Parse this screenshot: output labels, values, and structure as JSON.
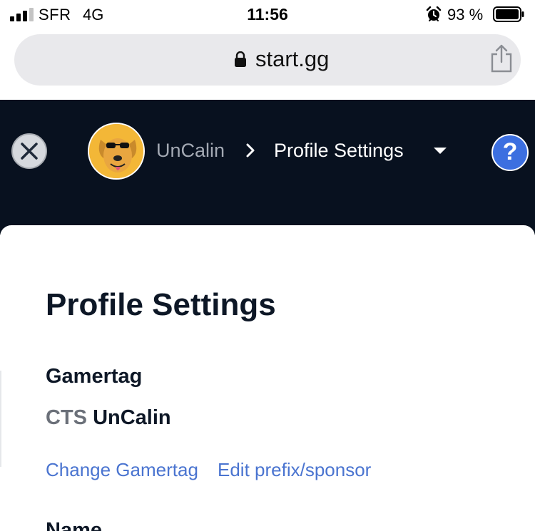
{
  "status_bar": {
    "carrier": "SFR",
    "network": "4G",
    "time": "11:56",
    "battery_percent": "93 %",
    "signal_bars": 3,
    "signal_bars_total": 4,
    "icons": [
      "signal-icon",
      "alarm-icon",
      "battery-icon"
    ]
  },
  "browser": {
    "url": "start.gg",
    "icons": [
      "lock-icon",
      "share-icon"
    ]
  },
  "header": {
    "breadcrumb_user": "UnCalin",
    "breadcrumb_page": "Profile Settings",
    "help_label": "?",
    "icons": [
      "close-icon",
      "avatar",
      "chevron-right-icon",
      "caret-down-icon",
      "help-icon"
    ]
  },
  "main": {
    "title": "Profile Settings",
    "gamertag_section": {
      "label": "Gamertag",
      "prefix": "CTS",
      "gamertag": "UnCalin"
    },
    "links": {
      "change_gamertag": "Change Gamertag",
      "edit_prefix": "Edit prefix/sponsor"
    },
    "name_section": {
      "label": "Name"
    }
  },
  "colors": {
    "header_bg": "#08111f",
    "link": "#4a74d0",
    "help_button": "#3c6fe0",
    "avatar_bg": "#f3b737",
    "heading_text": "#0d1726"
  }
}
